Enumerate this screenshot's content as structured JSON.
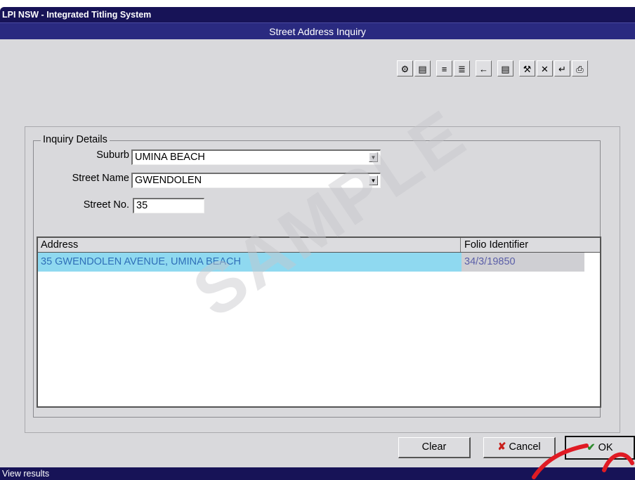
{
  "window": {
    "title": "LPI NSW - Integrated Titling System"
  },
  "form": {
    "title": "Street Address Inquiry"
  },
  "toolbar": {
    "buttons": [
      {
        "icon": "help-icon",
        "glyph": "⚙"
      },
      {
        "icon": "document-icon",
        "glyph": "▤"
      },
      {
        "icon": "split-icon",
        "glyph": "≡"
      },
      {
        "icon": "split-all-icon",
        "glyph": "≣"
      },
      {
        "icon": "arrow-left-icon",
        "glyph": "←"
      },
      {
        "icon": "page-icon",
        "glyph": "▤"
      },
      {
        "icon": "exit-icon",
        "glyph": "⚒"
      },
      {
        "icon": "close-icon",
        "glyph": "✕"
      },
      {
        "icon": "return-icon",
        "glyph": "↵"
      },
      {
        "icon": "print-icon",
        "glyph": "⎙"
      }
    ]
  },
  "inquiry": {
    "legend": "Inquiry Details",
    "suburb_label": "Suburb",
    "suburb_value": "UMINA BEACH",
    "street_name_label": "Street Name",
    "street_name_value": "GWENDOLEN",
    "street_no_label": "Street No.",
    "street_no_value": "35"
  },
  "results": {
    "columns": [
      "Address",
      "Folio Identifier"
    ],
    "rows": [
      {
        "address": "35 GWENDOLEN AVENUE, UMINA BEACH",
        "folio": "34/3/19850"
      }
    ]
  },
  "buttons": {
    "clear": "Clear",
    "cancel": "Cancel",
    "ok": "OK"
  },
  "status": {
    "text": "View results"
  },
  "watermark": {
    "text": "SAMPLE"
  },
  "colors": {
    "titlebar": "#171357",
    "subtitle": "#2a2a80",
    "selected_row": "#8fd9f0",
    "selected_row_text": "#2f6fb8",
    "folio_cell": "#cfcfd3",
    "folio_text": "#5b5fa8"
  }
}
